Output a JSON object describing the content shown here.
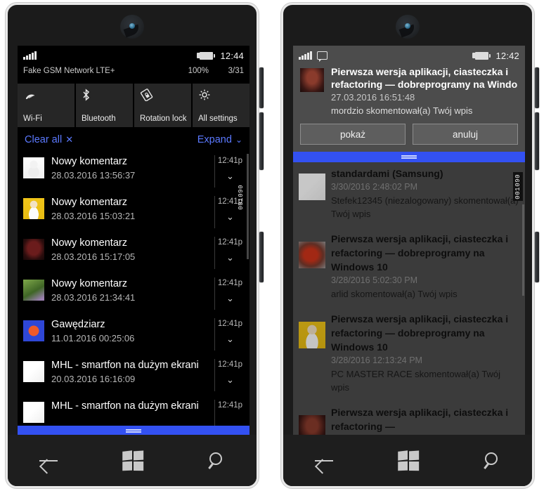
{
  "left_phone": {
    "status": {
      "signal_icon": "signal-bars-icon",
      "battery_icon": "battery-charging-icon",
      "time": "12:44",
      "carrier": "Fake GSM Network LTE+",
      "battery_percent": "100%",
      "date": "3/31"
    },
    "quick_actions": [
      {
        "label": "Wi-Fi",
        "icon": "wifi-icon"
      },
      {
        "label": "Bluetooth",
        "icon": "bluetooth-icon"
      },
      {
        "label": "Rotation lock",
        "icon": "rotation-lock-icon"
      },
      {
        "label": "All settings",
        "icon": "gear-icon"
      }
    ],
    "action_center": {
      "clear_all_label": "Clear all",
      "clear_all_icon": "close-x-icon",
      "expand_label": "Expand",
      "expand_icon": "chevron-down-icon"
    },
    "notifications": [
      {
        "title": "Nowy komentarz",
        "subtitle": "28.03.2016 13:56:37",
        "time": "12:41p",
        "thumb": "t-snowman",
        "chevron": "chevron-down-icon"
      },
      {
        "title": "Nowy komentarz",
        "subtitle": "28.03.2016 15:03:21",
        "time": "12:41p",
        "thumb": "t-yellow",
        "chevron": "chevron-down-icon"
      },
      {
        "title": "Nowy komentarz",
        "subtitle": "28.03.2016 15:17:05",
        "time": "12:41p",
        "thumb": "t-red",
        "chevron": "chevron-down-icon"
      },
      {
        "title": "Nowy komentarz",
        "subtitle": "28.03.2016 21:34:41",
        "time": "12:41p",
        "thumb": "t-green",
        "chevron": "chevron-down-icon"
      },
      {
        "title": "Gawędziarz",
        "subtitle": "11.01.2016 00:25:06",
        "time": "12:41p",
        "thumb": "t-flower",
        "chevron": "chevron-down-icon"
      },
      {
        "title": "MHL - smartfon na dużym ekrani",
        "subtitle": "20.03.2016 16:16:09",
        "time": "12:41p",
        "thumb": "t-mhl",
        "chevron": "chevron-down-icon"
      },
      {
        "title": "MHL - smartfon na dużym ekrani",
        "subtitle": "",
        "time": "12:41p",
        "thumb": "t-mhl",
        "chevron": ""
      }
    ],
    "overlay_tag": {
      "top": "090",
      "bottom": "001"
    },
    "navbar": [
      {
        "icon": "back-arrow-icon"
      },
      {
        "icon": "windows-start-icon"
      },
      {
        "icon": "search-icon"
      }
    ]
  },
  "right_phone": {
    "status": {
      "signal_icon": "signal-bars-icon",
      "message_icon": "message-bubble-icon",
      "battery_icon": "battery-charging-icon",
      "time": "12:42"
    },
    "toast": {
      "title": "Pierwsza wersja aplikacji, ciasteczka i refactoring  — dobreprogramy na Windo",
      "date": "27.03.2016 16:51:48",
      "message": "mordzio skomentował(a) Twój wpis",
      "thumb": "t-dark",
      "buttons": [
        {
          "label": "pokaż"
        },
        {
          "label": "anuluj"
        }
      ]
    },
    "feed": [
      {
        "title": "standardami (Samsung)",
        "date": "3/30/2016 2:48:02 PM",
        "message": "Stefek12345 (niezalogowany) skomentował(a) Twój wpis",
        "thumb": "t-mhl"
      },
      {
        "title": "Pierwsza wersja aplikacji, ciasteczka i refactoring  — dobreprogramy na Windows 10",
        "date": "3/28/2016 5:02:30 PM",
        "message": "arlid skomentował(a) Twój wpis",
        "thumb": "t-spider"
      },
      {
        "title": "Pierwsza wersja aplikacji, ciasteczka i refactoring  — dobreprogramy na Windows 10",
        "date": "3/28/2016 12:13:24 PM",
        "message": "PC MASTER RACE skomentował(a) Twój wpis",
        "thumb": "t-yellow"
      },
      {
        "title": "Pierwsza wersja aplikacji, ciasteczka i refactoring  —",
        "date": "",
        "message": "",
        "thumb": "t-dark"
      }
    ],
    "overlay_tag": {
      "top": "090",
      "bottom": "001"
    },
    "navbar": [
      {
        "icon": "back-arrow-icon"
      },
      {
        "icon": "windows-start-icon"
      },
      {
        "icon": "search-icon"
      }
    ]
  },
  "colors": {
    "accent_blue": "#3351f2",
    "link_blue": "#5b79ff",
    "dark_screen": "#000000",
    "gray_screen": "#4c4c4c",
    "toast_button": "#5e5e5e"
  }
}
